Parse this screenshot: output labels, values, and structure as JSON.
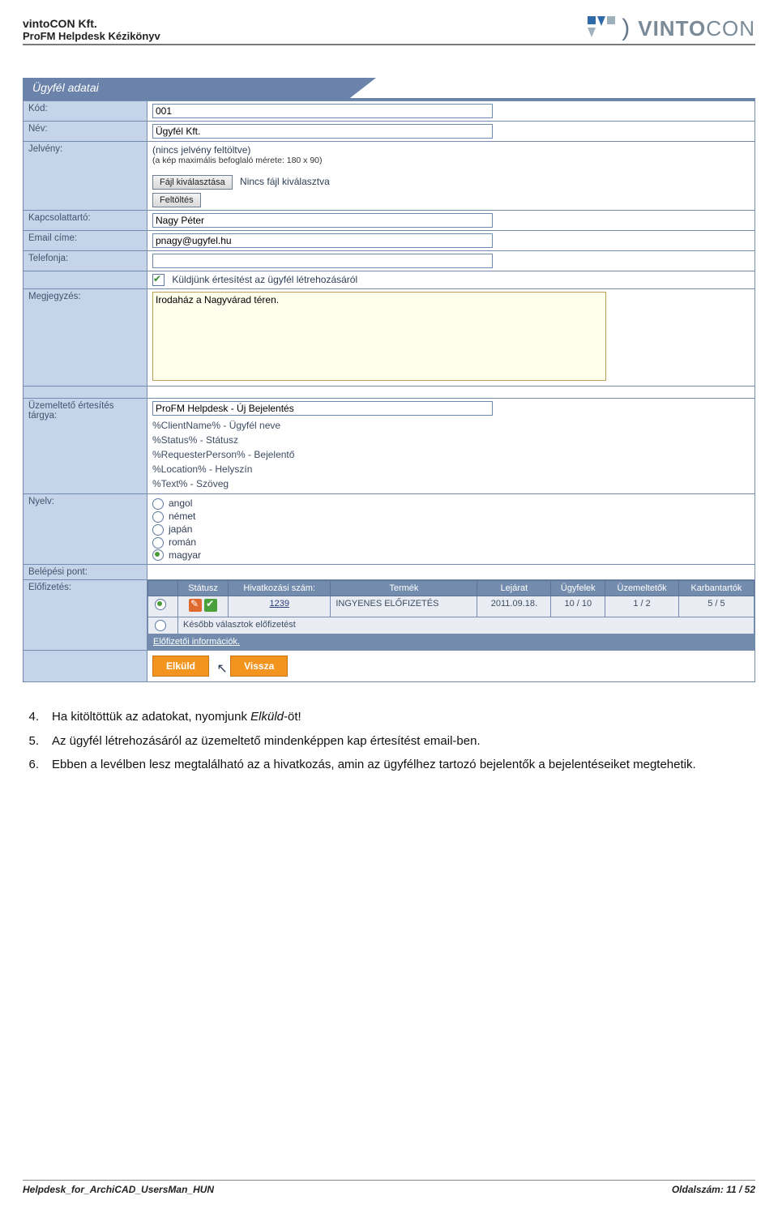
{
  "doc": {
    "company": "vintoCON Kft.",
    "title": "ProFM Helpdesk Kézikönyv",
    "footer_left": "Helpdesk_for_ArchiCAD_UsersMan_HUN",
    "footer_right": "Oldalszám: 11 / 52",
    "logo_text": "VINTOCON"
  },
  "form": {
    "header": "Ügyfél adatai",
    "labels": {
      "kod": "Kód:",
      "nev": "Név:",
      "jelveny": "Jelvény:",
      "kapcs": "Kapcsolattartó:",
      "email": "Email címe:",
      "telefon": "Telefonja:",
      "megj": "Megjegyzés:",
      "uzem": "Üzemeltető értesítés tárgya:",
      "nyelv": "Nyelv:",
      "belepes": "Belépési pont:",
      "elofiz": "Előfizetés:"
    },
    "values": {
      "kod": "001",
      "nev": "Ügyfél Kft.",
      "jelveny_none": "(nincs jelvény feltöltve)",
      "jelveny_hint": "(a kép maximális befoglaló mérete: 180 x 90)",
      "file_btn": "Fájl kiválasztása",
      "file_none": "Nincs fájl kiválasztva",
      "upload_btn": "Feltöltés",
      "kapcs": "Nagy Péter",
      "email": "pnagy@ugyfel.hu",
      "telefon": "",
      "notify_chk": "Küldjünk értesítést az ügyfél létrehozásáról",
      "megj": "Irodaház a Nagyvárad téren.",
      "uzem_subject": "ProFM Helpdesk - Új Bejelentés",
      "placeholders": [
        "%ClientName% - Ügyfél neve",
        "%Status% - Státusz",
        "%RequesterPerson% - Bejelentő",
        "%Location% - Helyszín",
        "%Text% - Szöveg"
      ],
      "languages": [
        "angol",
        "német",
        "japán",
        "román",
        "magyar"
      ],
      "lang_selected": 4
    },
    "sub": {
      "headers": [
        "Státusz",
        "Hivatkozási szám:",
        "Termék",
        "Lejárat",
        "Ügyfelek",
        "Üzemeltetők",
        "Karbantartók"
      ],
      "row": {
        "ref": "1239",
        "product": "INGYENES ELŐFIZETÉS",
        "expiry": "2011.09.18.",
        "clients": "10 / 10",
        "operators": "1 / 2",
        "maint": "5 / 5"
      },
      "later": "Később választok előfizetést",
      "info": "Előfizetői információk."
    },
    "buttons": {
      "send": "Elküld",
      "back": "Vissza"
    }
  },
  "body": {
    "items": [
      {
        "n": "4.",
        "t_pre": "Ha kitöltöttük az adatokat, nyomjunk ",
        "t_em": "Elküld",
        "t_post": "-öt!"
      },
      {
        "n": "5.",
        "t_pre": "Az ügyfél létrehozásáról az üzemeltető mindenképpen kap értesítést email-ben.",
        "t_em": "",
        "t_post": ""
      },
      {
        "n": "6.",
        "t_pre": "Ebben a levélben lesz megtalálható az a hivatkozás, amin az ügyfélhez tartozó bejelentők a bejelentéseiket megtehetik.",
        "t_em": "",
        "t_post": ""
      }
    ]
  }
}
